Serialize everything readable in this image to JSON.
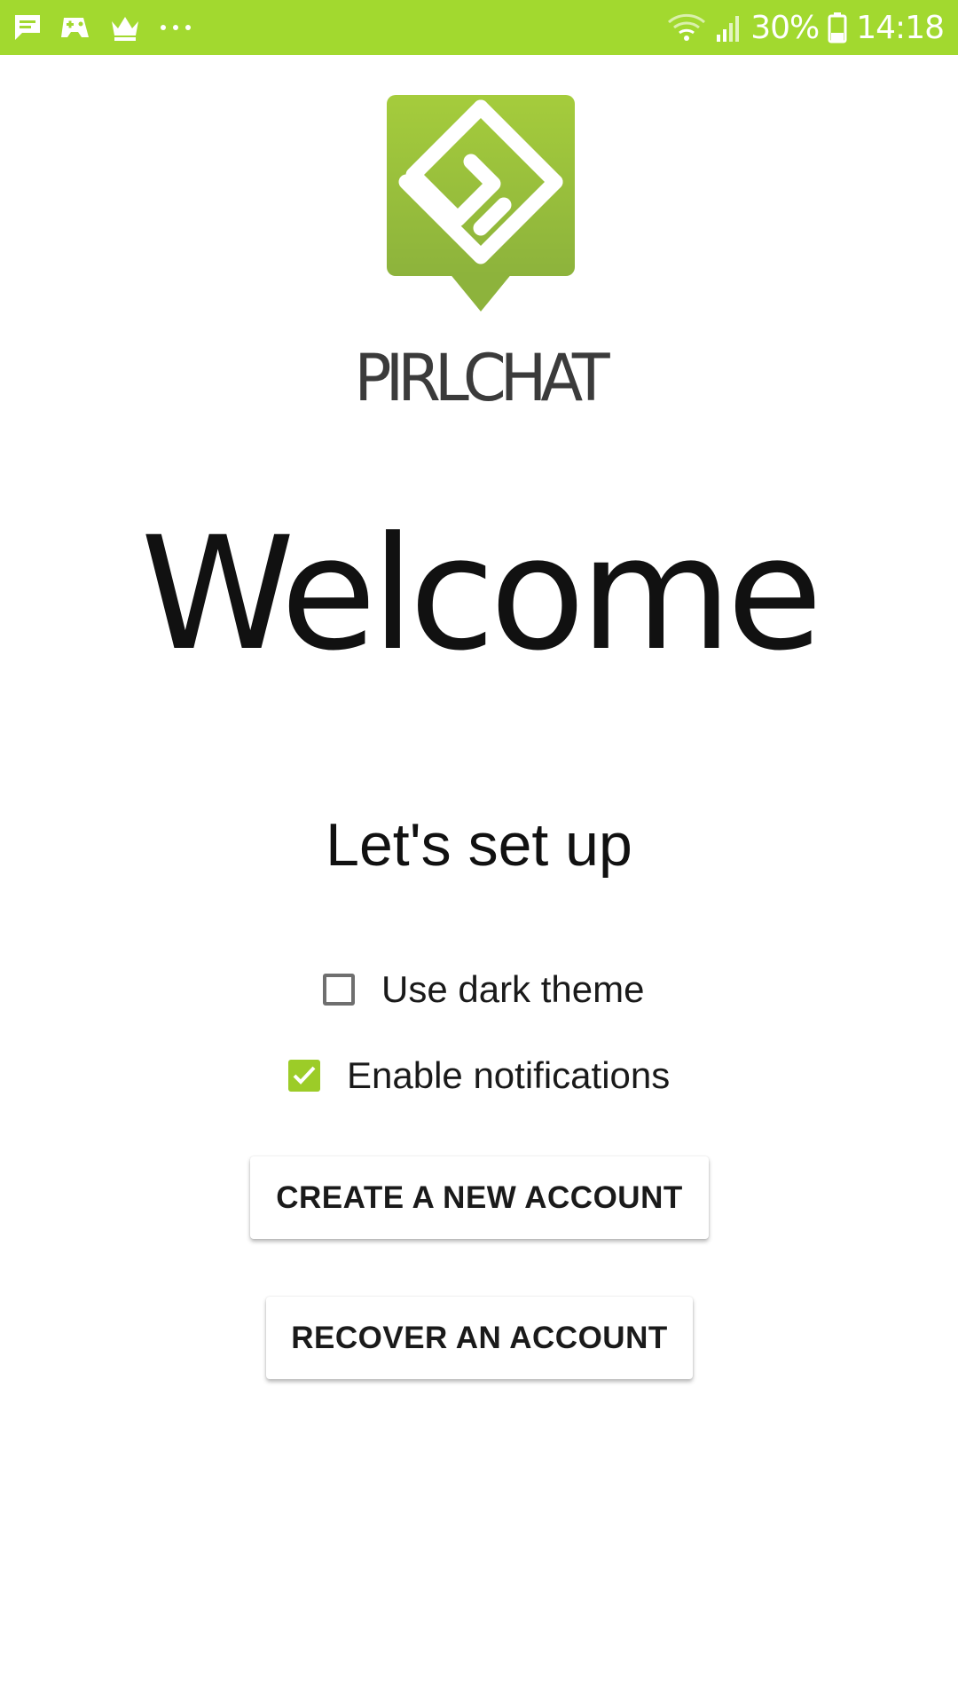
{
  "status_bar": {
    "background": "#a2d92f",
    "left_icons": [
      "message-icon",
      "game-controller-icon",
      "crown-icon",
      "more-dots-icon"
    ],
    "battery_percent": "30%",
    "time": "14:18",
    "right_icons": [
      "wifi-icon",
      "signal-icon",
      "battery-icon"
    ]
  },
  "logo": {
    "icon": "pirlchat-logo-icon",
    "wordmark": "PIRLCHAT",
    "brand_color": "#9ccc28"
  },
  "welcome": {
    "title": "Welcome",
    "subtitle": "Let's set up"
  },
  "options": {
    "dark_theme": {
      "label": "Use dark theme",
      "checked": false
    },
    "notifications": {
      "label": "Enable notifications",
      "checked": true
    }
  },
  "buttons": {
    "create_account": "CREATE A NEW ACCOUNT",
    "recover_account": "RECOVER AN ACCOUNT"
  }
}
